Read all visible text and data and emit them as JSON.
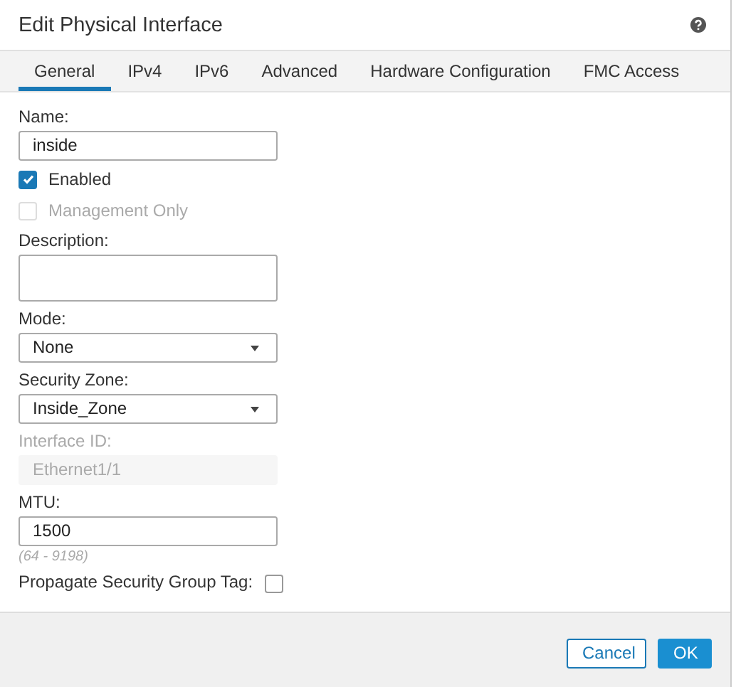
{
  "window": {
    "title": "Edit Physical Interface"
  },
  "tabs": [
    {
      "label": "General",
      "selected": true
    },
    {
      "label": "IPv4",
      "selected": false
    },
    {
      "label": "IPv6",
      "selected": false
    },
    {
      "label": "Advanced",
      "selected": false
    },
    {
      "label": "Hardware Configuration",
      "selected": false
    },
    {
      "label": "FMC Access",
      "selected": false
    }
  ],
  "fields": [
    {
      "kind": "text",
      "label": "Name:",
      "value": "inside",
      "disabled": false
    },
    {
      "kind": "checkbox",
      "label": "Enabled",
      "checked": true,
      "disabled": false
    },
    {
      "kind": "checkbox",
      "label": "Management Only",
      "checked": false,
      "disabled": true
    },
    {
      "kind": "textarea",
      "label": "Description:"
    },
    {
      "kind": "select",
      "label": "Mode:",
      "value": "None"
    },
    {
      "kind": "select",
      "label": "Security Zone:",
      "value": "Inside_Zone"
    },
    {
      "kind": "text",
      "label": "Interface ID:",
      "value": "Ethernet1/1",
      "disabled": true
    },
    {
      "kind": "text",
      "label": "MTU:",
      "value": "1500",
      "disabled": false,
      "hint": "(64 - 9198)"
    },
    {
      "kind": "inline-checkbox",
      "label": "Propagate Security Group Tag:",
      "checked": false,
      "disabled": false
    }
  ],
  "buttons": [
    {
      "label": "Cancel",
      "kind": "secondary"
    },
    {
      "label": "OK",
      "kind": "primary"
    }
  ]
}
